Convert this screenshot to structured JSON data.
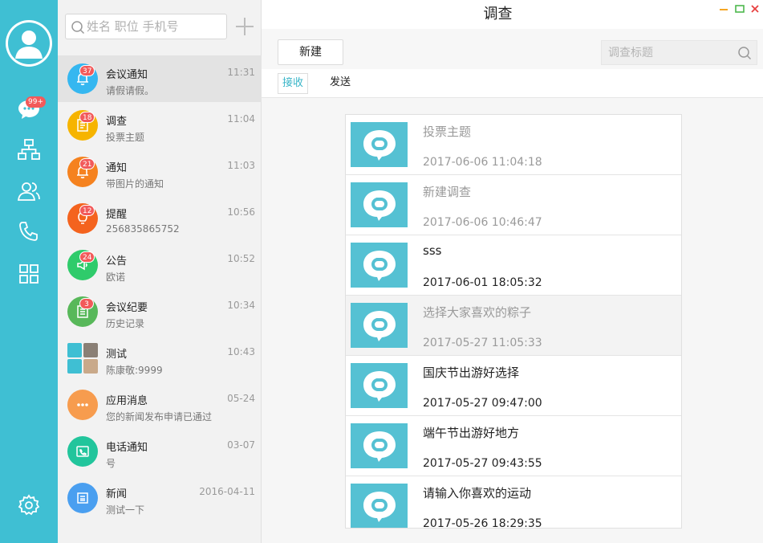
{
  "app": {
    "title": "调查",
    "accent": "#3fbfd3"
  },
  "rail": {
    "chat_badge": "99+",
    "items": [
      "chat-icon",
      "org-chart-icon",
      "contacts-icon",
      "phone-icon",
      "apps-grid-icon",
      "settings-icon"
    ]
  },
  "search": {
    "placeholder": "姓名 职位 手机号"
  },
  "conversations": [
    {
      "title": "会议通知",
      "subtitle": "请假请假。",
      "time": "11:31",
      "badge": "37",
      "color": "#35b7f0",
      "icon": "bell-icon"
    },
    {
      "title": "调查",
      "subtitle": "投票主题",
      "time": "11:04",
      "badge": "18",
      "color": "#f6b400",
      "icon": "survey-icon"
    },
    {
      "title": "通知",
      "subtitle": "带图片的通知",
      "time": "11:03",
      "badge": "21",
      "color": "#f5821f",
      "icon": "bell-icon"
    },
    {
      "title": "提醒",
      "subtitle": "256835865752",
      "time": "10:56",
      "badge": "12",
      "color": "#f4631e",
      "icon": "bulb-icon"
    },
    {
      "title": "公告",
      "subtitle": "欧诺",
      "time": "10:52",
      "badge": "24",
      "color": "#2fcb6b",
      "icon": "megaphone-icon"
    },
    {
      "title": "会议纪要",
      "subtitle": "历史记录",
      "time": "10:34",
      "badge": "3",
      "color": "#58b85a",
      "icon": "notes-icon"
    },
    {
      "title": "测试",
      "subtitle": "陈康敬:9999",
      "time": "10:43",
      "badge": "",
      "color": "#ffffff",
      "icon": "group-avatar"
    },
    {
      "title": "应用消息",
      "subtitle": "您的新闻发布申请已通过",
      "time": "05-24",
      "badge": "",
      "color": "#f79c4e",
      "icon": "more-icon"
    },
    {
      "title": "电话通知",
      "subtitle": "号",
      "time": "03-07",
      "badge": "",
      "color": "#22c59c",
      "icon": "phone-card-icon"
    },
    {
      "title": "新闻",
      "subtitle": "测试一下",
      "time": "2016-04-11",
      "badge": "",
      "color": "#4a9ff0",
      "icon": "news-icon"
    }
  ],
  "toolbar": {
    "new_label": "新建",
    "search_placeholder": "调查标题"
  },
  "tabs": [
    {
      "label": "接收",
      "active": true
    },
    {
      "label": "发送",
      "active": false
    }
  ],
  "surveys": [
    {
      "title": "投票主题",
      "time": "2017-06-06 11:04:18",
      "style": "dim"
    },
    {
      "title": "新建调查",
      "time": "2017-06-06 10:46:47",
      "style": "dim"
    },
    {
      "title": "sss",
      "time": "2017-06-01 18:05:32",
      "style": "norm"
    },
    {
      "title": "选择大家喜欢的粽子",
      "time": "2017-05-27 11:05:33",
      "style": "dim-hl"
    },
    {
      "title": "国庆节出游好选择",
      "time": "2017-05-27 09:47:00",
      "style": "norm"
    },
    {
      "title": "端午节出游好地方",
      "time": "2017-05-27 09:43:55",
      "style": "norm"
    },
    {
      "title": "请输入你喜欢的运动",
      "time": "2017-05-26 18:29:35",
      "style": "norm"
    }
  ]
}
